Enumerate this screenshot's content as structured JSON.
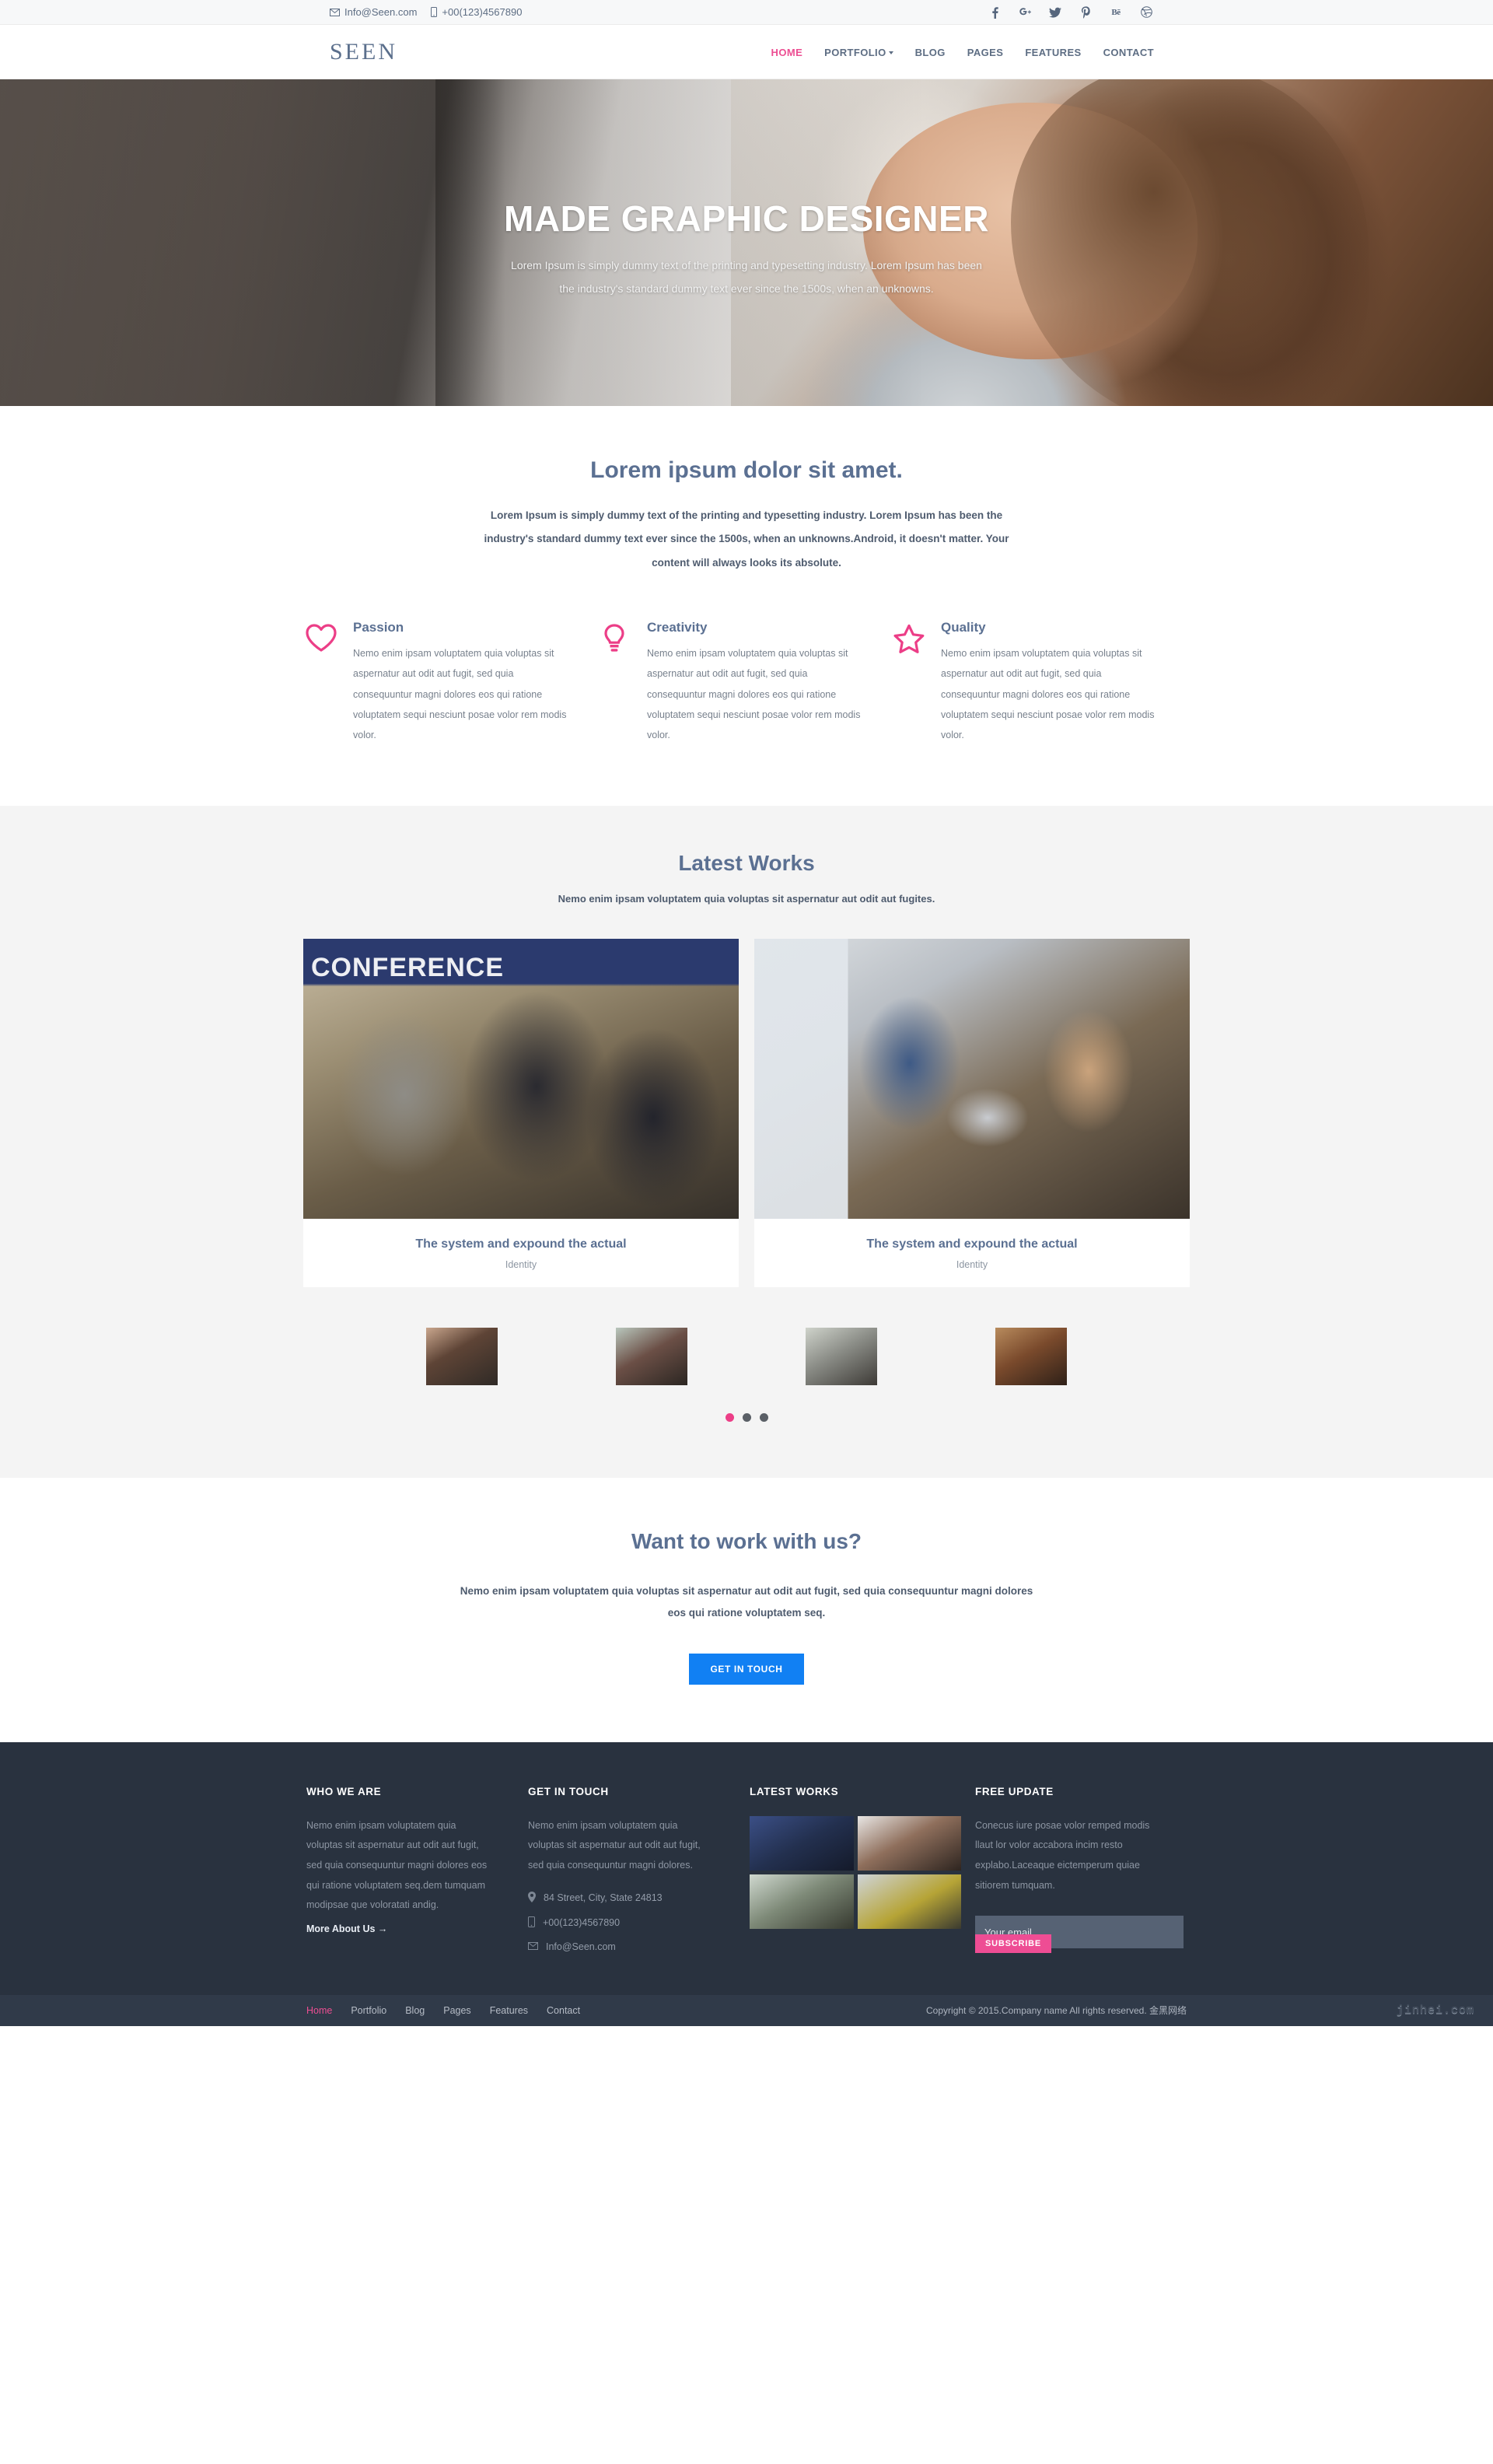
{
  "topbar": {
    "email": "Info@Seen.com",
    "phone": "+00(123)4567890",
    "social": [
      {
        "name": "facebook-icon",
        "label": "f"
      },
      {
        "name": "google-plus-icon",
        "label": "g+"
      },
      {
        "name": "twitter-icon",
        "label": "t"
      },
      {
        "name": "pinterest-icon",
        "label": "p"
      },
      {
        "name": "behance-icon",
        "label": "Bē"
      },
      {
        "name": "dribbble-icon",
        "label": "d"
      }
    ]
  },
  "header": {
    "logo": "SEEN",
    "nav": [
      {
        "label": "HOME",
        "active": true,
        "caret": false
      },
      {
        "label": "PORTFOLIO",
        "active": false,
        "caret": true
      },
      {
        "label": "BLOG",
        "active": false,
        "caret": false
      },
      {
        "label": "PAGES",
        "active": false,
        "caret": false
      },
      {
        "label": "FEATURES",
        "active": false,
        "caret": false
      },
      {
        "label": "CONTACT",
        "active": false,
        "caret": false
      }
    ]
  },
  "hero": {
    "title": "MADE GRAPHIC DESIGNER",
    "line1": "Lorem Ipsum is simply dummy text of the printing and typesetting industry. Lorem Ipsum has been",
    "line2": "the industry's standard dummy text ever since the 1500s, when an unknowns."
  },
  "intro": {
    "heading": "Lorem ipsum dolor sit amet.",
    "body": "Lorem Ipsum is simply dummy text of the printing and typesetting industry. Lorem Ipsum has been the industry's standard dummy text ever since the 1500s, when an unknowns.Android, it doesn't matter. Your content will always looks its absolute."
  },
  "features": [
    {
      "icon": "heart-icon",
      "title": "Passion",
      "text": "Nemo enim ipsam voluptatem quia voluptas sit aspernatur aut odit aut fugit, sed quia consequuntur magni dolores eos qui ratione voluptatem sequi nesciunt posae volor rem modis volor."
    },
    {
      "icon": "lightbulb-icon",
      "title": "Creativity",
      "text": "Nemo enim ipsam voluptatem quia voluptas sit aspernatur aut odit aut fugit, sed quia consequuntur magni dolores eos qui ratione voluptatem sequi nesciunt posae volor rem modis volor."
    },
    {
      "icon": "star-icon",
      "title": "Quality",
      "text": "Nemo enim ipsam voluptatem quia voluptas sit aspernatur aut odit aut fugit, sed quia consequuntur magni dolores eos qui ratione voluptatem sequi nesciunt posae volor rem modis volor."
    }
  ],
  "works": {
    "heading": "Latest Works",
    "subheading": "Nemo enim ipsam voluptatem quia voluptas sit aspernatur aut odit aut fugites.",
    "cards": [
      {
        "title": "The system and expound the actual",
        "category": "Identity"
      },
      {
        "title": "The system and expound the actual",
        "category": "Identity"
      }
    ],
    "thumbnails": [
      "thumb-1",
      "thumb-2",
      "thumb-3",
      "thumb-4"
    ],
    "dots": [
      true,
      false,
      false
    ]
  },
  "cta": {
    "heading": "Want to work with us?",
    "body": "Nemo enim ipsam voluptatem quia voluptas sit aspernatur aut odit aut fugit, sed quia consequuntur magni dolores eos qui ratione voluptatem seq.",
    "button": "GET IN TOUCH"
  },
  "footer": {
    "who": {
      "heading": "WHO WE ARE",
      "text": "Nemo enim ipsam voluptatem quia voluptas sit aspernatur aut odit aut fugit, sed quia consequuntur magni dolores eos qui ratione voluptatem seq.dem tumquam modipsae que voloratati andig.",
      "link": "More About Us →"
    },
    "touch": {
      "heading": "GET IN TOUCH",
      "text": "Nemo enim ipsam voluptatem quia voluptas sit aspernatur aut odit aut fugit, sed quia consequuntur magni dolores.",
      "address": "84 Street, City, State 24813",
      "phone": "+00(123)4567890",
      "email": "Info@Seen.com"
    },
    "latest": {
      "heading": "LATEST WORKS"
    },
    "update": {
      "heading": "FREE UPDATE",
      "text": "Conecus iure posae volor remped modis llaut lor volor accabora incim resto explabo.Laceaque eictemperum quiae sitiorem tumquam.",
      "placeholder": "Your email...",
      "button": "SUBSCRIBE"
    }
  },
  "bottom": {
    "nav": [
      {
        "label": "Home",
        "active": true
      },
      {
        "label": "Portfolio",
        "active": false
      },
      {
        "label": "Blog",
        "active": false
      },
      {
        "label": "Pages",
        "active": false
      },
      {
        "label": "Features",
        "active": false
      },
      {
        "label": "Contact",
        "active": false
      }
    ],
    "copyright": "Copyright © 2015.Company name All rights reserved.  金黑网络",
    "watermark": "jinhei.com"
  },
  "colors": {
    "pink": "#ec4e92",
    "blue": "#1180f3",
    "slate": "#5b7092",
    "footer_bg": "#29323f"
  }
}
